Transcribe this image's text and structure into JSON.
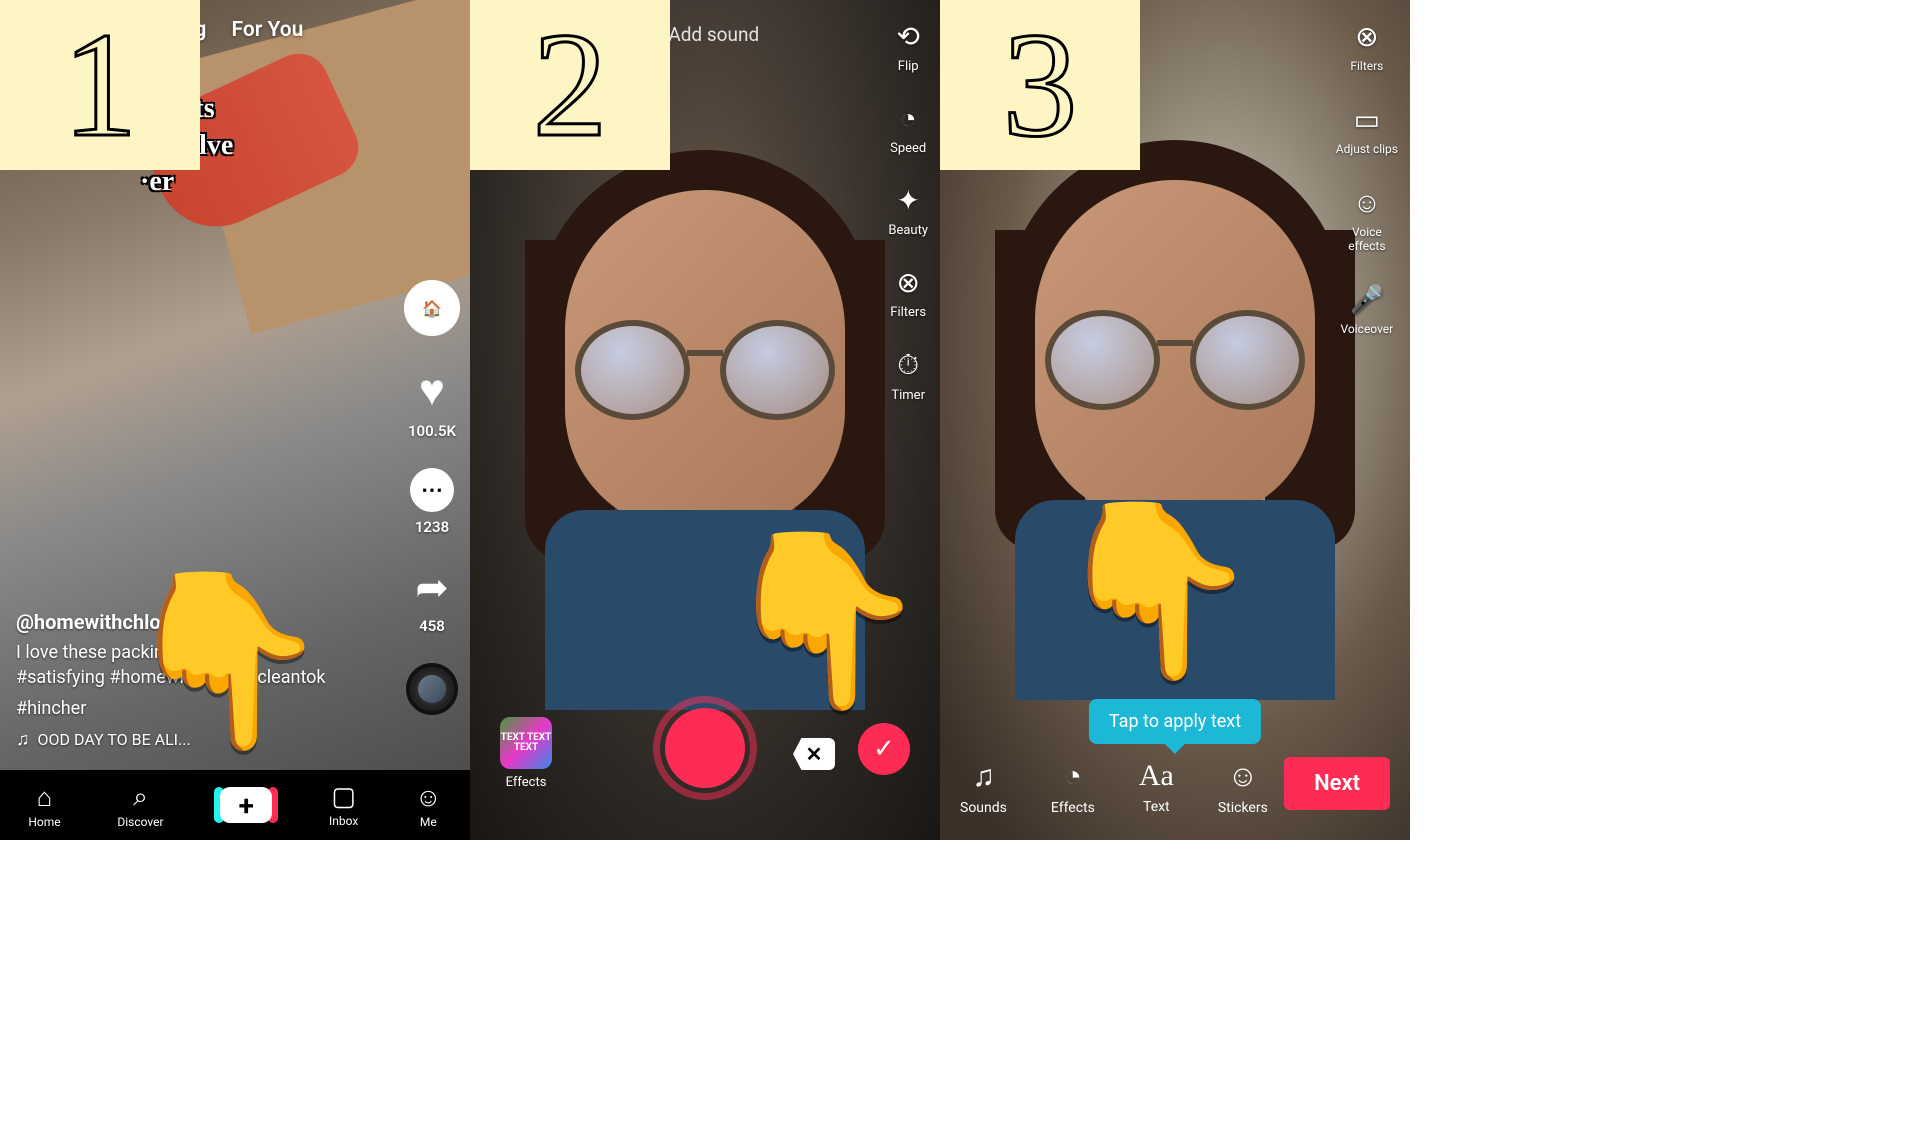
{
  "steps": [
    "1",
    "2",
    "3"
  ],
  "pointer": "👇",
  "panel1": {
    "tabs": {
      "following": "ving",
      "for_you": "For You"
    },
    "overlay_text": "now,\na-nuts\ndissolve\n·er",
    "likes": "100.5K",
    "comments": "1238",
    "shares": "458",
    "username": "@homewithchloex",
    "caption_line1": "I love these packin...",
    "hashtags1": "#satisfying #homewithc...ex #cleantok",
    "hashtags2": "#hincher",
    "sound": "OOD DAY TO BE ALI...",
    "nav": {
      "home": "Home",
      "discover": "Discover",
      "create": "+",
      "inbox": "Inbox",
      "me": "Me"
    }
  },
  "panel2": {
    "add_sound": "Add sound",
    "rail": {
      "flip": "Flip",
      "speed": "Speed",
      "beauty": "Beauty",
      "filters": "Filters",
      "timer": "Timer"
    },
    "effects_label": "Effects",
    "effects_tile": "TEXT TEXT TEXT"
  },
  "panel3": {
    "rail": {
      "filters": "Filters",
      "adjust": "Adjust clips",
      "voice_effects": "Voice\neffects",
      "voiceover": "Voiceover"
    },
    "tooltip": "Tap to apply text",
    "bottom": {
      "sounds": "Sounds",
      "effects": "Effects",
      "text": "Text",
      "stickers": "Stickers"
    },
    "next": "Next"
  }
}
